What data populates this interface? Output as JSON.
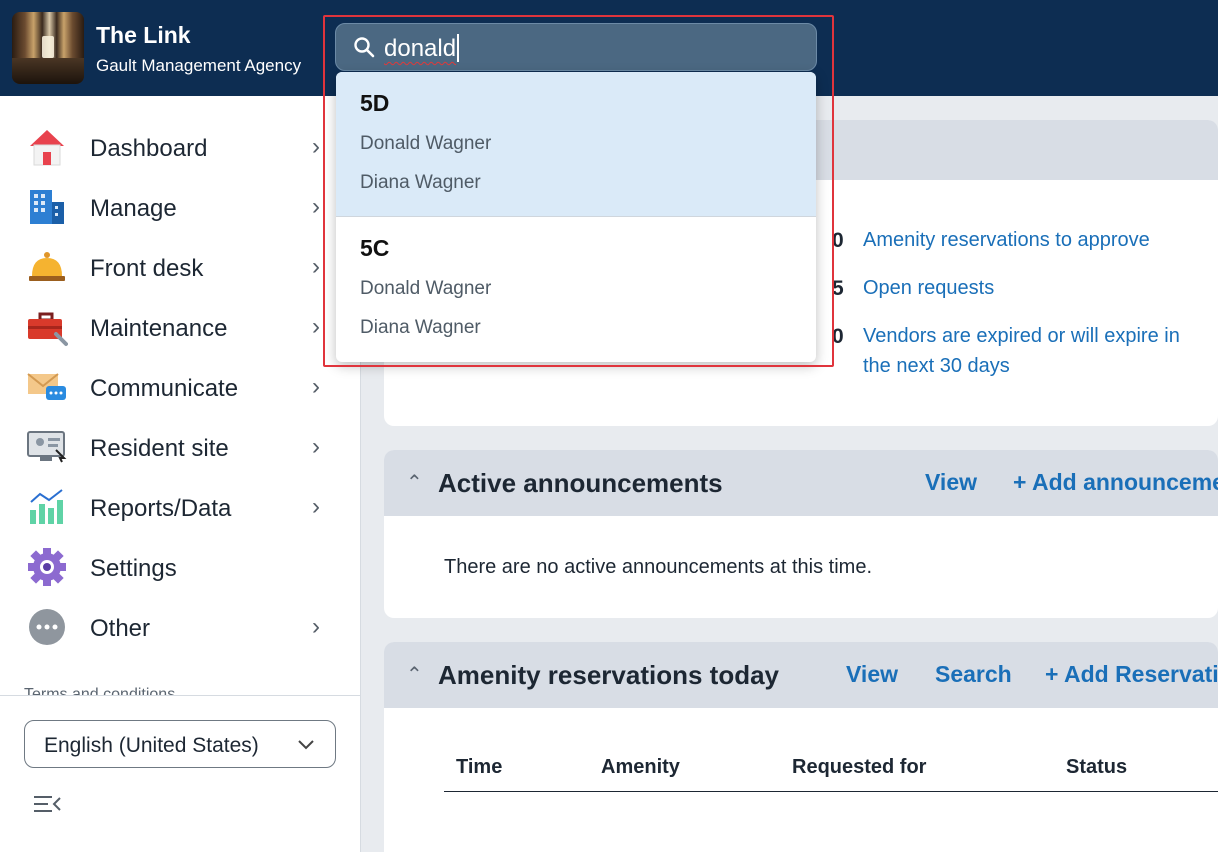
{
  "header": {
    "title": "The Link",
    "subtitle": "Gault Management Agency"
  },
  "search": {
    "value": "donald",
    "results": [
      {
        "unit": "5D",
        "names": [
          "Donald Wagner",
          "Diana Wagner"
        ]
      },
      {
        "unit": "5C",
        "names": [
          "Donald Wagner",
          "Diana Wagner"
        ]
      }
    ]
  },
  "sidebar": {
    "items": [
      {
        "label": "Dashboard",
        "icon": "house-icon",
        "chevron": true
      },
      {
        "label": "Manage",
        "icon": "building-icon",
        "chevron": true
      },
      {
        "label": "Front desk",
        "icon": "bell-icon",
        "chevron": true
      },
      {
        "label": "Maintenance",
        "icon": "toolbox-icon",
        "chevron": true
      },
      {
        "label": "Communicate",
        "icon": "mail-chat-icon",
        "chevron": true
      },
      {
        "label": "Resident site",
        "icon": "monitor-icon",
        "chevron": true
      },
      {
        "label": "Reports/Data",
        "icon": "chart-icon",
        "chevron": true
      },
      {
        "label": "Settings",
        "icon": "gear-icon",
        "chevron": false
      },
      {
        "label": "Other",
        "icon": "more-icon",
        "chevron": true
      }
    ],
    "terms": "Terms and conditions",
    "language": "English (United States)"
  },
  "stats": [
    {
      "count": "0",
      "label": "Amenity reservations to approve"
    },
    {
      "count": "5",
      "label": "Open requests"
    },
    {
      "count": "0",
      "label": "Vendors are expired or will expire in the next 30 days"
    }
  ],
  "announcements": {
    "title": "Active announcements",
    "view": "View",
    "add": "+ Add announcement",
    "empty": "There are no active announcements at this time."
  },
  "reservations": {
    "title": "Amenity reservations today",
    "view": "View",
    "search": "Search",
    "add": "+ Add Reservation",
    "columns": [
      "Time",
      "Amenity",
      "Requested for",
      "Status"
    ]
  },
  "colors": {
    "header_bg": "#0d2d52",
    "link": "#1a6fb8",
    "highlight": "#daeaf8",
    "focus_outline": "#e0343c"
  }
}
